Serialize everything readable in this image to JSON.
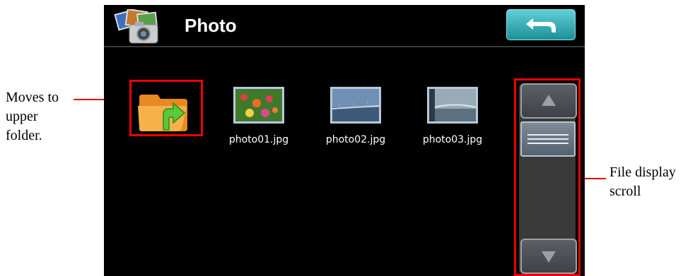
{
  "title": "Photo",
  "back_icon": "back-arrow-icon",
  "app_icon": "photo-camera-icon",
  "upper_folder_icon": "folder-up-icon",
  "files": [
    {
      "name": "photo01.jpg"
    },
    {
      "name": "photo02.jpg"
    },
    {
      "name": "photo03.jpg"
    }
  ],
  "scroll": {
    "up_icon": "triangle-up-icon",
    "down_icon": "triangle-down-icon",
    "thumb_icon": "grip-lines-icon"
  },
  "annotations": {
    "upper_folder_lines": [
      "Moves to",
      "upper",
      "folder."
    ],
    "scroll_lines": [
      "File display",
      "scroll"
    ]
  },
  "colors": {
    "screen_bg": "#000000",
    "back_button": "#2aa7b0",
    "annotation_red": "#e00000"
  }
}
